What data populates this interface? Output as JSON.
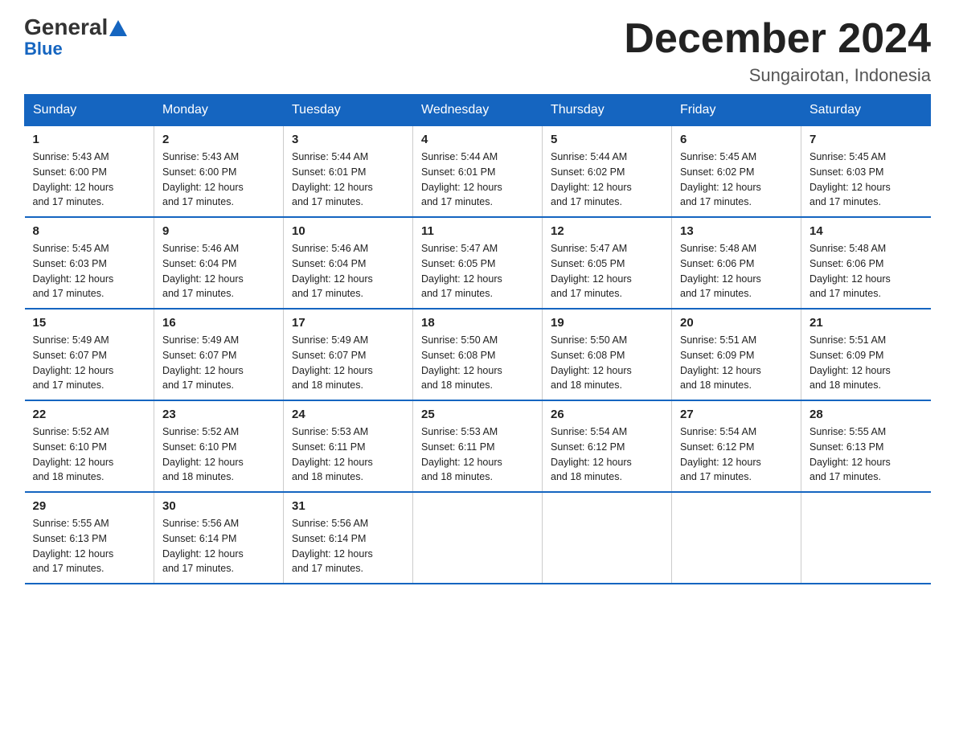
{
  "logo": {
    "general": "General",
    "triangle": "▲",
    "blue": "Blue"
  },
  "header": {
    "title": "December 2024",
    "subtitle": "Sungairotan, Indonesia"
  },
  "days_of_week": [
    "Sunday",
    "Monday",
    "Tuesday",
    "Wednesday",
    "Thursday",
    "Friday",
    "Saturday"
  ],
  "weeks": [
    [
      {
        "day": "1",
        "sunrise": "5:43 AM",
        "sunset": "6:00 PM",
        "daylight": "12 hours and 17 minutes."
      },
      {
        "day": "2",
        "sunrise": "5:43 AM",
        "sunset": "6:00 PM",
        "daylight": "12 hours and 17 minutes."
      },
      {
        "day": "3",
        "sunrise": "5:44 AM",
        "sunset": "6:01 PM",
        "daylight": "12 hours and 17 minutes."
      },
      {
        "day": "4",
        "sunrise": "5:44 AM",
        "sunset": "6:01 PM",
        "daylight": "12 hours and 17 minutes."
      },
      {
        "day": "5",
        "sunrise": "5:44 AM",
        "sunset": "6:02 PM",
        "daylight": "12 hours and 17 minutes."
      },
      {
        "day": "6",
        "sunrise": "5:45 AM",
        "sunset": "6:02 PM",
        "daylight": "12 hours and 17 minutes."
      },
      {
        "day": "7",
        "sunrise": "5:45 AM",
        "sunset": "6:03 PM",
        "daylight": "12 hours and 17 minutes."
      }
    ],
    [
      {
        "day": "8",
        "sunrise": "5:45 AM",
        "sunset": "6:03 PM",
        "daylight": "12 hours and 17 minutes."
      },
      {
        "day": "9",
        "sunrise": "5:46 AM",
        "sunset": "6:04 PM",
        "daylight": "12 hours and 17 minutes."
      },
      {
        "day": "10",
        "sunrise": "5:46 AM",
        "sunset": "6:04 PM",
        "daylight": "12 hours and 17 minutes."
      },
      {
        "day": "11",
        "sunrise": "5:47 AM",
        "sunset": "6:05 PM",
        "daylight": "12 hours and 17 minutes."
      },
      {
        "day": "12",
        "sunrise": "5:47 AM",
        "sunset": "6:05 PM",
        "daylight": "12 hours and 17 minutes."
      },
      {
        "day": "13",
        "sunrise": "5:48 AM",
        "sunset": "6:06 PM",
        "daylight": "12 hours and 17 minutes."
      },
      {
        "day": "14",
        "sunrise": "5:48 AM",
        "sunset": "6:06 PM",
        "daylight": "12 hours and 17 minutes."
      }
    ],
    [
      {
        "day": "15",
        "sunrise": "5:49 AM",
        "sunset": "6:07 PM",
        "daylight": "12 hours and 17 minutes."
      },
      {
        "day": "16",
        "sunrise": "5:49 AM",
        "sunset": "6:07 PM",
        "daylight": "12 hours and 17 minutes."
      },
      {
        "day": "17",
        "sunrise": "5:49 AM",
        "sunset": "6:07 PM",
        "daylight": "12 hours and 18 minutes."
      },
      {
        "day": "18",
        "sunrise": "5:50 AM",
        "sunset": "6:08 PM",
        "daylight": "12 hours and 18 minutes."
      },
      {
        "day": "19",
        "sunrise": "5:50 AM",
        "sunset": "6:08 PM",
        "daylight": "12 hours and 18 minutes."
      },
      {
        "day": "20",
        "sunrise": "5:51 AM",
        "sunset": "6:09 PM",
        "daylight": "12 hours and 18 minutes."
      },
      {
        "day": "21",
        "sunrise": "5:51 AM",
        "sunset": "6:09 PM",
        "daylight": "12 hours and 18 minutes."
      }
    ],
    [
      {
        "day": "22",
        "sunrise": "5:52 AM",
        "sunset": "6:10 PM",
        "daylight": "12 hours and 18 minutes."
      },
      {
        "day": "23",
        "sunrise": "5:52 AM",
        "sunset": "6:10 PM",
        "daylight": "12 hours and 18 minutes."
      },
      {
        "day": "24",
        "sunrise": "5:53 AM",
        "sunset": "6:11 PM",
        "daylight": "12 hours and 18 minutes."
      },
      {
        "day": "25",
        "sunrise": "5:53 AM",
        "sunset": "6:11 PM",
        "daylight": "12 hours and 18 minutes."
      },
      {
        "day": "26",
        "sunrise": "5:54 AM",
        "sunset": "6:12 PM",
        "daylight": "12 hours and 18 minutes."
      },
      {
        "day": "27",
        "sunrise": "5:54 AM",
        "sunset": "6:12 PM",
        "daylight": "12 hours and 17 minutes."
      },
      {
        "day": "28",
        "sunrise": "5:55 AM",
        "sunset": "6:13 PM",
        "daylight": "12 hours and 17 minutes."
      }
    ],
    [
      {
        "day": "29",
        "sunrise": "5:55 AM",
        "sunset": "6:13 PM",
        "daylight": "12 hours and 17 minutes."
      },
      {
        "day": "30",
        "sunrise": "5:56 AM",
        "sunset": "6:14 PM",
        "daylight": "12 hours and 17 minutes."
      },
      {
        "day": "31",
        "sunrise": "5:56 AM",
        "sunset": "6:14 PM",
        "daylight": "12 hours and 17 minutes."
      },
      null,
      null,
      null,
      null
    ]
  ],
  "labels": {
    "sunrise": "Sunrise:",
    "sunset": "Sunset:",
    "daylight": "Daylight:"
  }
}
